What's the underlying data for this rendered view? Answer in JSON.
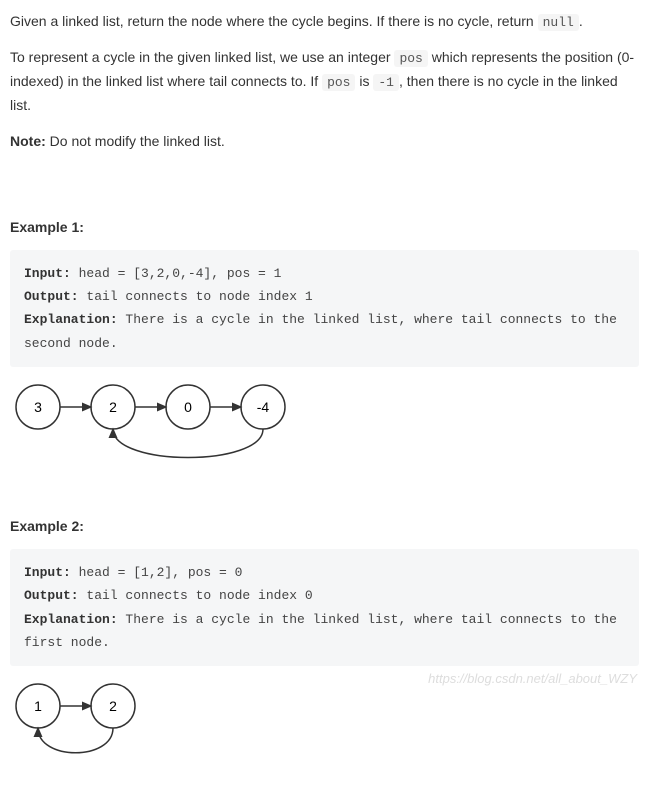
{
  "intro": {
    "p1_a": "Given a linked list, return the node where the cycle begins. If there is no cycle, return ",
    "p1_code": "null",
    "p1_b": ".",
    "p2_a": "To represent a cycle in the given linked list, we use an integer ",
    "p2_code1": "pos",
    "p2_b": " which represents the position (0-indexed) in the linked list where tail connects to. If ",
    "p2_code2": "pos",
    "p2_c": " is ",
    "p2_code3": "-1",
    "p2_d": ", then there is no cycle in the linked list.",
    "note_label": "Note:",
    "note_text": " Do not modify the linked list."
  },
  "example1": {
    "heading": "Example 1:",
    "input_label": "Input:",
    "input_text": " head = [3,2,0,-4], pos = 1",
    "output_label": "Output:",
    "output_text": " tail connects to node index 1",
    "explanation_label": "Explanation:",
    "explanation_text": " There is a cycle in the linked list, where tail connects to the second node.",
    "diagram_nodes": [
      "3",
      "2",
      "0",
      "-4"
    ]
  },
  "example2": {
    "heading": "Example 2:",
    "input_label": "Input:",
    "input_text": " head = [1,2], pos = 0",
    "output_label": "Output:",
    "output_text": " tail connects to node index 0",
    "explanation_label": "Explanation:",
    "explanation_text": " There is a cycle in the linked list, where tail connects to the first node.",
    "diagram_nodes": [
      "1",
      "2"
    ]
  },
  "watermark": "https://blog.csdn.net/all_about_WZY"
}
